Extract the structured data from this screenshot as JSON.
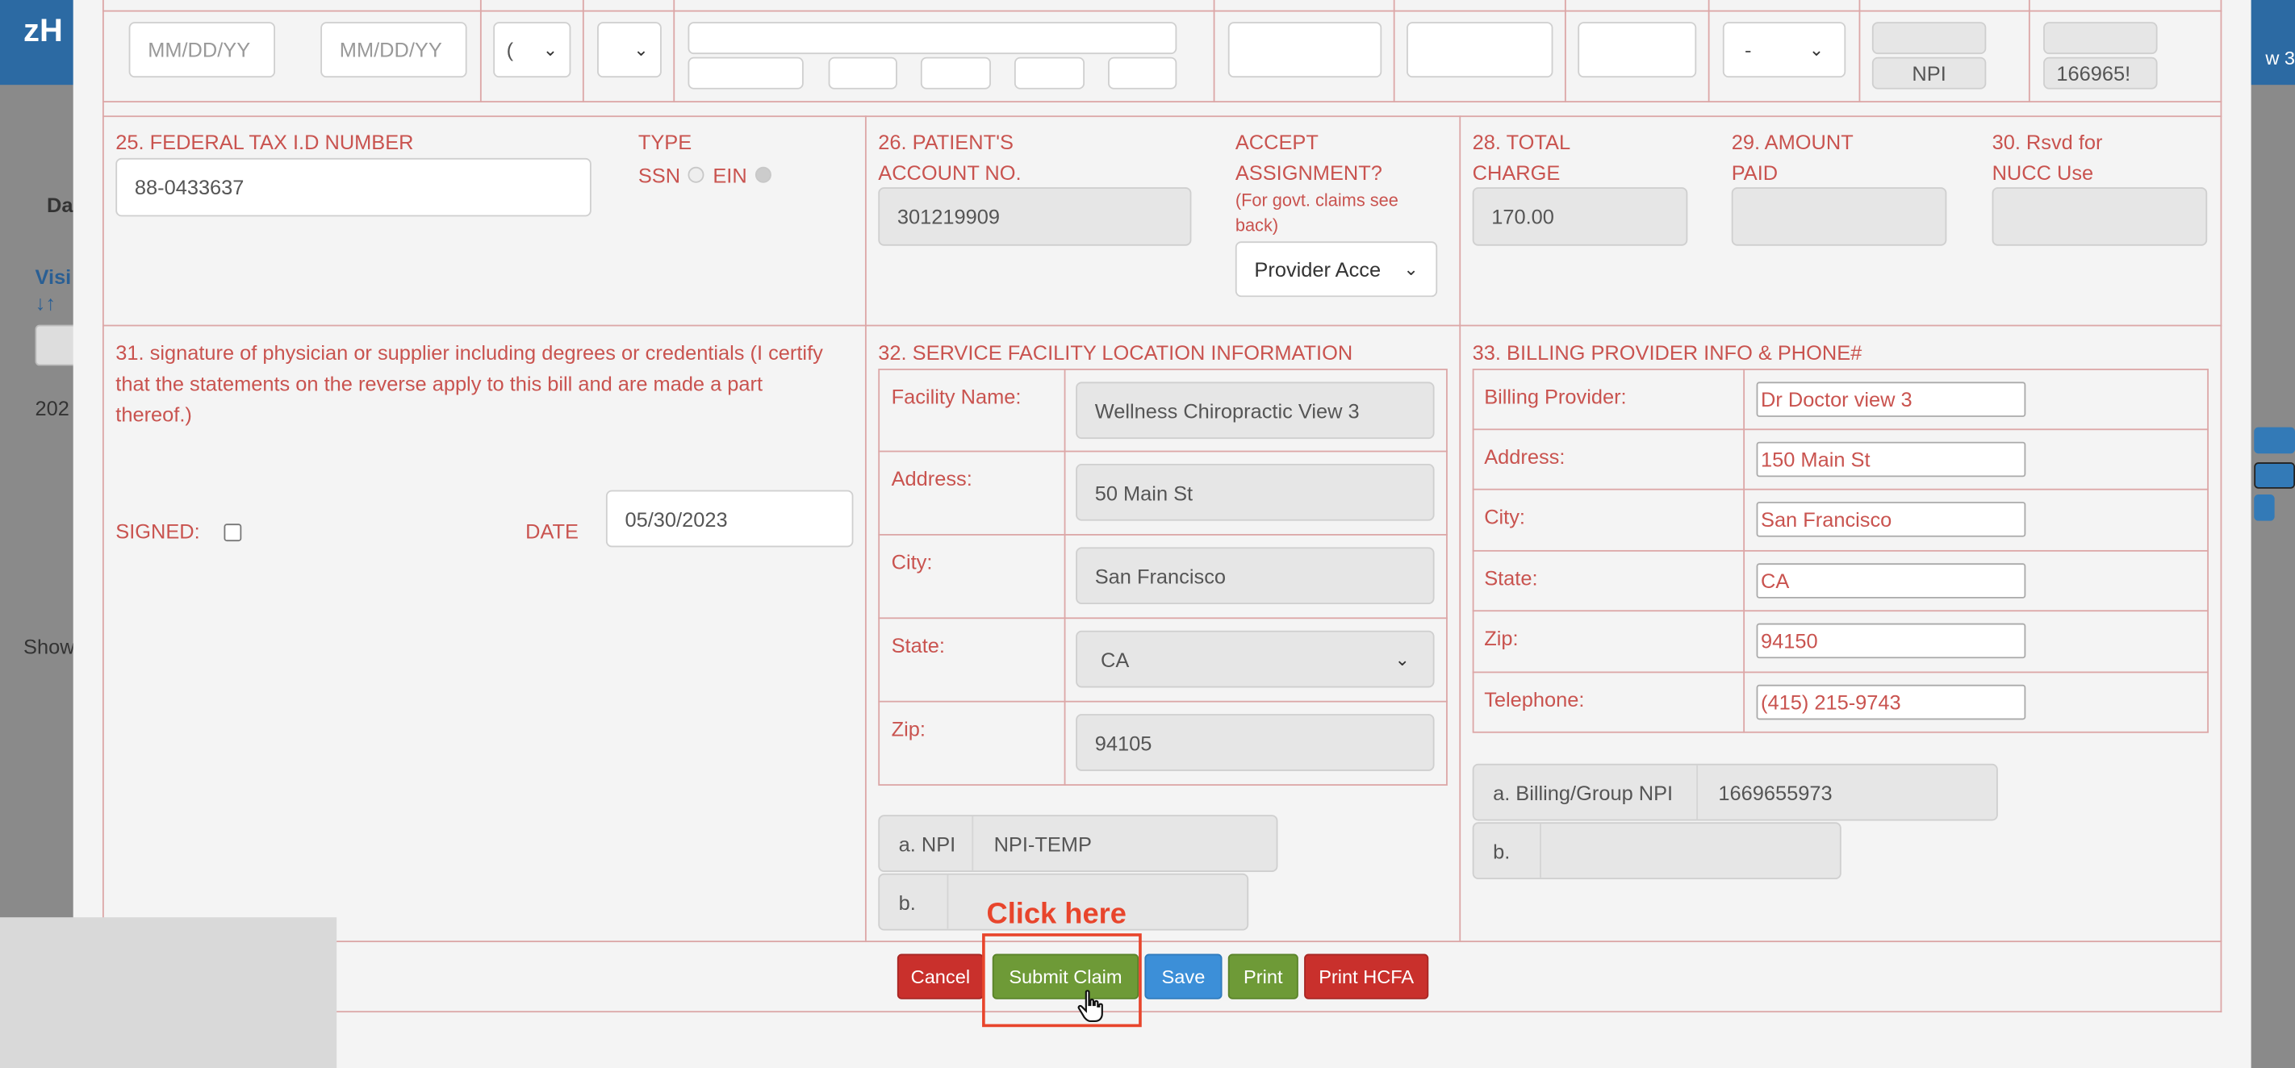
{
  "background": {
    "logo": "zH",
    "right_text": "w 3",
    "label_da": "Da",
    "label_visit": "Visi",
    "label_sort": "↓↑",
    "label_202": "202",
    "label_show": "Show"
  },
  "top_row": {
    "date_from_placeholder": "MM/DD/YY",
    "date_to_placeholder": "MM/DD/YY",
    "select_a": "(",
    "select_b": "",
    "select_c": "-",
    "npi_label": "NPI",
    "npi_value": "166965!"
  },
  "box25": {
    "label": "25. FEDERAL TAX I.D NUMBER",
    "value": "88-0433637",
    "type_label": "TYPE",
    "ssn": "SSN",
    "ein": "EIN"
  },
  "box26": {
    "label_line1": "26. PATIENT'S",
    "label_line2": "ACCOUNT NO.",
    "value": "301219909"
  },
  "box27": {
    "label_line1": "ACCEPT",
    "label_line2": "ASSIGNMENT?",
    "note_line1": "(For govt. claims see",
    "note_line2": "back)",
    "selected": "Provider Acce"
  },
  "box28": {
    "label_line1": "28. TOTAL",
    "label_line2": "CHARGE",
    "value": "170.00"
  },
  "box29": {
    "label_line1": "29. AMOUNT",
    "label_line2": "PAID",
    "value": ""
  },
  "box30": {
    "label_line1": "30. Rsvd for",
    "label_line2": "NUCC Use",
    "value": ""
  },
  "box31": {
    "line1": "31. signature of physician or supplier including degrees or credentials (I certify",
    "line2": "that the statements on the reverse apply to this bill and are made a part",
    "line3": "thereof.)",
    "signed_label": "SIGNED:",
    "date_label": "DATE",
    "date_value": "05/30/2023"
  },
  "box32": {
    "title": "32. SERVICE FACILITY LOCATION INFORMATION",
    "rows": [
      {
        "label": "Facility Name:",
        "value": "Wellness Chiropractic View 3"
      },
      {
        "label": "Address:",
        "value": "50 Main St"
      },
      {
        "label": "City:",
        "value": "San Francisco"
      },
      {
        "label": "State:",
        "value": "CA"
      },
      {
        "label": "Zip:",
        "value": "94105"
      }
    ],
    "npi_a_label": "a. NPI",
    "npi_a_value": "NPI-TEMP",
    "npi_b_label": "b.",
    "npi_b_value": ""
  },
  "box33": {
    "title": "33. BILLING PROVIDER INFO & PHONE#",
    "rows": [
      {
        "label": "Billing Provider:",
        "value": "Dr Doctor  view 3"
      },
      {
        "label": "Address:",
        "value": "150 Main St"
      },
      {
        "label": "City:",
        "value": "San Francisco"
      },
      {
        "label": "State:",
        "value": "CA"
      },
      {
        "label": "Zip:",
        "value": "94150"
      },
      {
        "label": "Telephone:",
        "value": "(415) 215-9743"
      }
    ],
    "npi_a_label": "a. Billing/Group NPI",
    "npi_a_value": "1669655973",
    "npi_b_label": "b.",
    "npi_b_value": ""
  },
  "buttons": {
    "cancel": "Cancel",
    "submit": "Submit Claim",
    "save": "Save",
    "print": "Print",
    "print_hcfa": "Print HCFA"
  },
  "callout": "Click here"
}
